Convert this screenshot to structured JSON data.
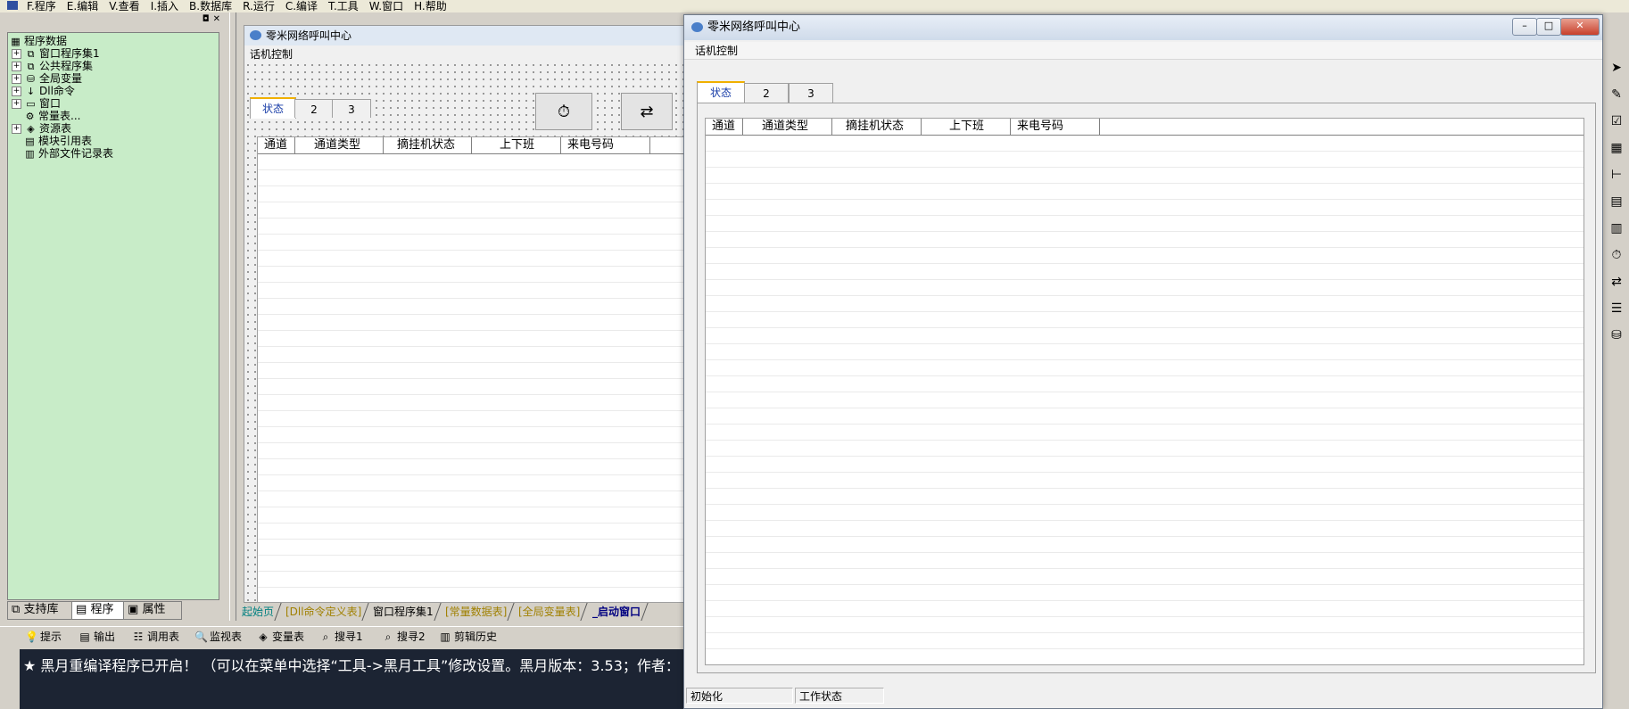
{
  "menubar": {
    "items": [
      "F.程序",
      "E.编辑",
      "V.查看",
      "I.插入",
      "B.数据库",
      "R.运行",
      "C.编译",
      "T.工具",
      "W.窗口",
      "H.帮助"
    ]
  },
  "tree": {
    "root": "程序数据",
    "nodes": [
      {
        "label": "窗口程序集1",
        "icon": "stack-icon",
        "expander": "+"
      },
      {
        "label": "公共程序集",
        "icon": "stack-icon",
        "expander": "+"
      },
      {
        "label": "全局变量",
        "icon": "db-icon",
        "expander": "+"
      },
      {
        "label": "Dll命令",
        "icon": "dll-icon",
        "expander": "+"
      },
      {
        "label": "窗口",
        "icon": "window-icon",
        "expander": "+"
      },
      {
        "label": "常量表...",
        "icon": "const-icon",
        "expander": ""
      },
      {
        "label": "资源表",
        "icon": "resource-icon",
        "expander": "+"
      },
      {
        "label": "模块引用表",
        "icon": "module-icon",
        "expander": ""
      },
      {
        "label": "外部文件记录表",
        "icon": "file-icon",
        "expander": ""
      }
    ]
  },
  "left_tabs": [
    "支持库",
    "程序",
    "属性"
  ],
  "designer": {
    "title": "零米网络呼叫中心",
    "menu": "话机控制",
    "tabs": [
      "状态",
      "2",
      "3"
    ],
    "columns": [
      "通道",
      "通道类型",
      "摘挂机状态",
      "上下班",
      "来电号码"
    ]
  },
  "doc_tabs": [
    {
      "label": "起始页",
      "style": "c"
    },
    {
      "label": "[Dll命令定义表]",
      "style": "y"
    },
    {
      "label": "窗口程序集1",
      "style": "n"
    },
    {
      "label": "[常量数据表]",
      "style": "y"
    },
    {
      "label": "[全局变量表]",
      "style": "y"
    },
    {
      "label": "_启动窗口",
      "style": "b"
    }
  ],
  "output_tabs": [
    {
      "label": "提示",
      "icon": "hint-icon"
    },
    {
      "label": "输出",
      "icon": "output-icon"
    },
    {
      "label": "调用表",
      "icon": "calltable-icon"
    },
    {
      "label": "监视表",
      "icon": "watch-icon"
    },
    {
      "label": "变量表",
      "icon": "variable-icon"
    },
    {
      "label": "搜寻1",
      "icon": "search1-icon"
    },
    {
      "label": "搜寻2",
      "icon": "search2-icon"
    },
    {
      "label": "剪辑历史",
      "icon": "clip-history-icon"
    }
  ],
  "output_text": "★ 黑月重编译程序已开启！ （可以在菜单中选择“工具->黑月工具”修改设置。黑月版本：3.53；作者：",
  "window": {
    "title": "零米网络呼叫中心",
    "menu": "话机控制",
    "tabs": [
      "状态",
      "2",
      "3"
    ],
    "columns": [
      "通道",
      "通道类型",
      "摘挂机状态",
      "上下班",
      "来电号码"
    ],
    "status": [
      "初始化",
      "工作状态"
    ]
  }
}
